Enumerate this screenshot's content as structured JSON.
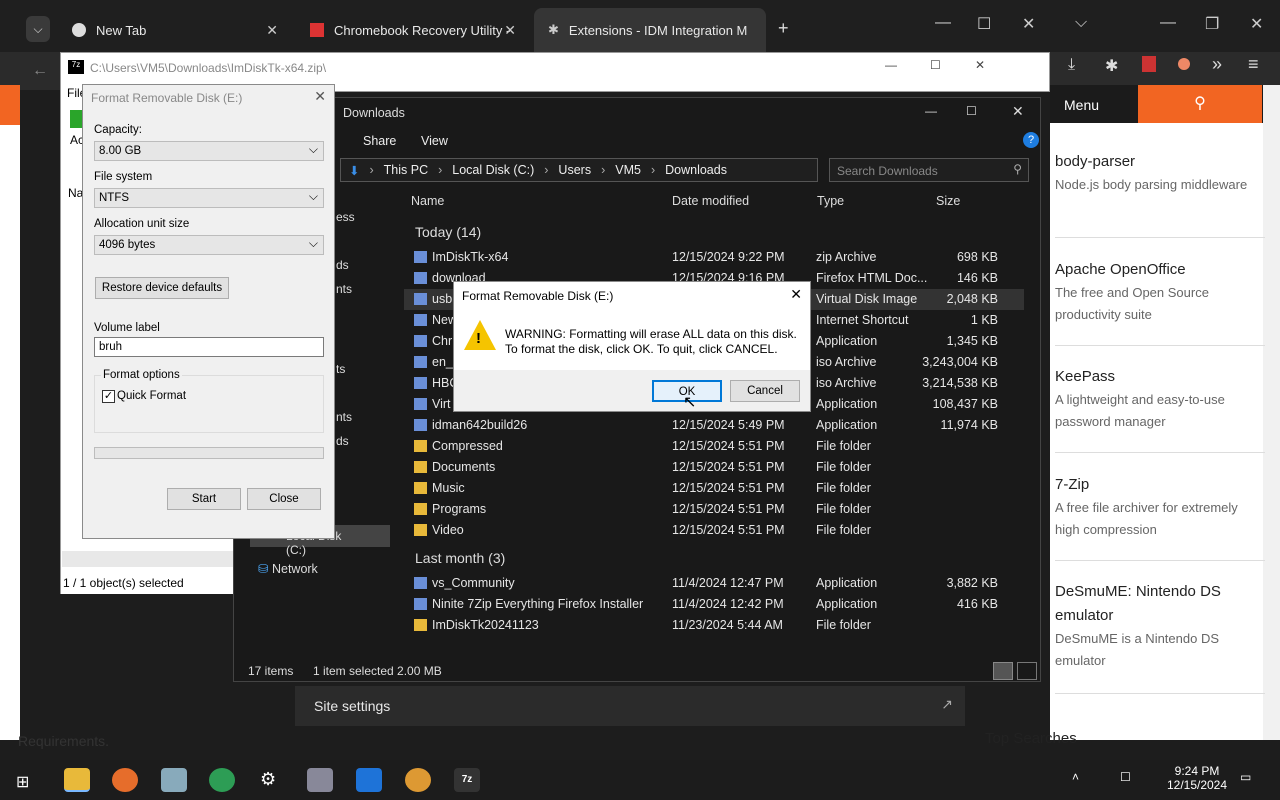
{
  "chrome": {
    "tabs": [
      "New Tab",
      "Chromebook Recovery Utility -",
      "Extensions - IDM Integration M"
    ]
  },
  "zip_window": {
    "path": "C:\\Users\\VM5\\Downloads\\ImDiskTk-x64.zip\\",
    "menu_file": "File",
    "partial_ac": "Ac",
    "partial_na": "Na",
    "status": "1 / 1 object(s) selected"
  },
  "explorer": {
    "title": "Downloads",
    "ribbon": [
      "Share",
      "View"
    ],
    "breadcrumb": [
      "This PC",
      "Local Disk (C:)",
      "Users",
      "VM5",
      "Downloads"
    ],
    "search_placeholder": "Search Downloads",
    "columns": {
      "name": "Name",
      "date": "Date modified",
      "type": "Type",
      "size": "Size"
    },
    "groups": {
      "today": "Today (14)",
      "last_month": "Last month (3)"
    },
    "rows": [
      {
        "name": "ImDiskTk-x64",
        "date": "12/15/2024 9:22 PM",
        "type": "zip Archive",
        "size": "698 KB"
      },
      {
        "name": "download",
        "date": "12/15/2024 9:16 PM",
        "type": "Firefox HTML Doc...",
        "size": "146 KB"
      },
      {
        "name": "usb",
        "date": "",
        "type": "Virtual Disk Image",
        "size": "2,048 KB"
      },
      {
        "name": "New",
        "date": "",
        "type": "Internet Shortcut",
        "size": "1 KB"
      },
      {
        "name": "Chr",
        "date": "",
        "type": "Application",
        "size": "1,345 KB"
      },
      {
        "name": "en_",
        "date": "",
        "type": "iso Archive",
        "size": "3,243,004 KB"
      },
      {
        "name": "HBC",
        "date": "",
        "type": "iso Archive",
        "size": "3,214,538 KB"
      },
      {
        "name": "Virt",
        "date": "",
        "type": "Application",
        "size": "108,437 KB"
      },
      {
        "name": "idman642build26",
        "date": "12/15/2024 5:49 PM",
        "type": "Application",
        "size": "11,974 KB"
      },
      {
        "name": "Compressed",
        "date": "12/15/2024 5:51 PM",
        "type": "File folder",
        "size": ""
      },
      {
        "name": "Documents",
        "date": "12/15/2024 5:51 PM",
        "type": "File folder",
        "size": ""
      },
      {
        "name": "Music",
        "date": "12/15/2024 5:51 PM",
        "type": "File folder",
        "size": ""
      },
      {
        "name": "Programs",
        "date": "12/15/2024 5:51 PM",
        "type": "File folder",
        "size": ""
      },
      {
        "name": "Video",
        "date": "12/15/2024 5:51 PM",
        "type": "File folder",
        "size": ""
      }
    ],
    "rows2": [
      {
        "name": "vs_Community",
        "date": "11/4/2024 12:47 PM",
        "type": "Application",
        "size": "3,882 KB"
      },
      {
        "name": "Ninite 7Zip Everything Firefox Installer",
        "date": "11/4/2024 12:42 PM",
        "type": "Application",
        "size": "416 KB"
      },
      {
        "name": "ImDiskTk20241123",
        "date": "11/23/2024 5:44 AM",
        "type": "File folder",
        "size": ""
      }
    ],
    "nav": {
      "partial1": "ess",
      "partial2": "ds",
      "partial3": "nts",
      "partial4": "ts",
      "partial5": "nts",
      "partial6": "ds",
      "disk": "Local Disk (C:)",
      "network": "Network"
    },
    "status": {
      "items": "17 items",
      "selected": "1 item selected  2.00 MB"
    }
  },
  "format_dialog": {
    "title": "Format Removable Disk (E:)",
    "capacity_label": "Capacity:",
    "capacity": "8.00 GB",
    "fs_label": "File system",
    "fs": "NTFS",
    "alloc_label": "Allocation unit size",
    "alloc": "4096 bytes",
    "restore": "Restore device defaults",
    "volume_label": "Volume label",
    "volume": "bruh",
    "options_label": "Format options",
    "quick": "Quick Format",
    "start": "Start",
    "close": "Close"
  },
  "warning": {
    "title": "Format Removable Disk (E:)",
    "line1": "WARNING: Formatting will erase ALL data on this disk.",
    "line2": "To format the disk, click OK. To quit, click CANCEL.",
    "ok": "OK",
    "cancel": "Cancel"
  },
  "site_settings": "Site settings",
  "requirements": "Requirements.",
  "right_page": {
    "menu": "Menu",
    "items": [
      {
        "title": "body-parser",
        "desc": "Node.js body parsing middleware"
      },
      {
        "title": "Apache OpenOffice",
        "desc": "The free and Open Source productivity suite"
      },
      {
        "title": "KeePass",
        "desc": "A lightweight and easy-to-use password manager"
      },
      {
        "title": "7-Zip",
        "desc": "A free file archiver for extremely high compression"
      },
      {
        "title": "DeSmuME: Nintendo DS emulator",
        "desc": "DeSmuME is a Nintendo DS emulator"
      }
    ],
    "footer": "Top Searches"
  },
  "taskbar": {
    "time": "9:24 PM",
    "date": "12/15/2024"
  },
  "colors": {
    "accent_orange": "#f26522",
    "dark": "#1f1f1f",
    "selection": "#cce8ff"
  }
}
